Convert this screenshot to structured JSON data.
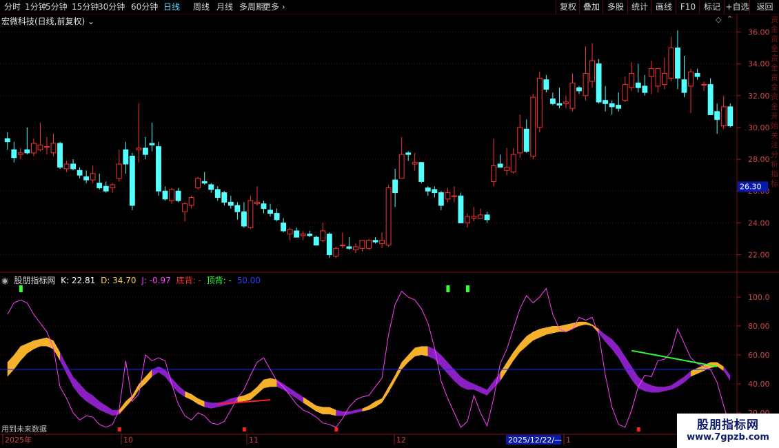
{
  "toolbar": {
    "periods": [
      "分时",
      "1分钟",
      "5分钟",
      "15分钟",
      "30分钟",
      "60分钟",
      "日线",
      "周线",
      "月线",
      "多周期",
      "更多 ›"
    ],
    "active_period": "日线",
    "actions": [
      "复权",
      "叠加",
      "多股",
      "统计",
      "画线",
      "F10",
      "标记",
      "+自选",
      "返回"
    ]
  },
  "stock_title": "宏微科技(日线,前复权) ⌄",
  "icons": {
    "diamond": "diamond-icon",
    "chevron": "chevron-up-icon",
    "circle": "indicator-menu-icon"
  },
  "price_axis": {
    "ticks": [
      "36.00",
      "34.00",
      "32.00",
      "30.00",
      "28.00",
      "26.00",
      "24.00",
      "22.00"
    ],
    "current": "26.30"
  },
  "indicator": {
    "name": "股朋指标网",
    "k": "K: 22.81",
    "d": "D: 34.70",
    "j": "J: -0.97",
    "bottom_div": "底背: -",
    "top_div": "顶背: -",
    "mid": "50.00",
    "ticks": [
      "100.0",
      "80.00",
      "60.00",
      "40.00",
      "20.00"
    ]
  },
  "footer_note": "用到未来数据",
  "date_axis": {
    "labels": [
      "2025年",
      "10",
      "11",
      "12",
      "1"
    ],
    "cursor": "2025/12/22/—"
  },
  "watermark": {
    "line1": "股朋指标网",
    "line2": "www.7gpzb.com"
  },
  "side_strip": "资金资金资金资金资金开始关注分析指标",
  "colors": {
    "up": "#ff3232",
    "down": "#54ffff",
    "kline": "#ff40ff",
    "gold": "#f5b12a",
    "purple": "#8a1fc4",
    "mid": "#1a2cff",
    "topdiv": "#33ff33",
    "botdiv": "#ff2020"
  },
  "chart_data": [
    {
      "type": "candlestick",
      "title": "宏微科技(日线,前复权)",
      "ylim": [
        21.2,
        36.8
      ],
      "ohlc": [
        [
          29.3,
          29.7,
          28.6,
          29.1
        ],
        [
          28.6,
          29.1,
          27.8,
          28.1
        ],
        [
          28.3,
          28.7,
          28.0,
          28.4
        ],
        [
          28.6,
          30.0,
          28.3,
          28.4
        ],
        [
          28.4,
          29.3,
          28.2,
          29.0
        ],
        [
          28.6,
          30.3,
          28.5,
          28.9
        ],
        [
          28.8,
          29.4,
          28.3,
          28.8
        ],
        [
          28.4,
          29.6,
          28.2,
          29.0
        ],
        [
          29.0,
          29.1,
          27.4,
          27.5
        ],
        [
          27.4,
          27.9,
          27.2,
          27.7
        ],
        [
          27.7,
          28.0,
          27.3,
          27.4
        ],
        [
          27.3,
          27.5,
          26.8,
          27.0
        ],
        [
          26.9,
          27.3,
          26.5,
          26.7
        ],
        [
          26.7,
          27.6,
          26.5,
          27.1
        ],
        [
          26.5,
          27.1,
          26.1,
          26.2
        ],
        [
          26.3,
          26.6,
          25.9,
          26.0
        ],
        [
          26.2,
          26.5,
          25.9,
          26.4
        ],
        [
          26.8,
          28.6,
          26.6,
          27.7
        ],
        [
          28.6,
          29.1,
          27.1,
          27.7
        ],
        [
          28.2,
          28.4,
          24.8,
          25.1
        ],
        [
          28.6,
          31.5,
          27.8,
          28.7
        ],
        [
          28.7,
          29.4,
          28.0,
          28.3
        ],
        [
          29.0,
          30.3,
          28.5,
          28.9
        ],
        [
          28.8,
          29.1,
          25.7,
          26.0
        ],
        [
          26.0,
          26.3,
          25.4,
          25.5
        ],
        [
          25.4,
          26.2,
          25.2,
          26.1
        ],
        [
          26.0,
          26.2,
          25.3,
          25.4
        ],
        [
          24.7,
          25.3,
          24.1,
          25.2
        ],
        [
          25.1,
          25.7,
          24.9,
          25.6
        ],
        [
          26.2,
          26.9,
          26.1,
          26.8
        ],
        [
          26.6,
          27.2,
          26.4,
          26.5
        ],
        [
          26.4,
          26.5,
          25.9,
          26.1
        ],
        [
          26.1,
          26.3,
          25.4,
          25.6
        ],
        [
          25.9,
          26.0,
          25.1,
          25.3
        ],
        [
          25.3,
          25.7,
          24.9,
          25.1
        ],
        [
          25.1,
          25.3,
          24.2,
          24.7
        ],
        [
          24.7,
          25.3,
          23.7,
          23.8
        ],
        [
          23.7,
          25.7,
          23.6,
          25.4
        ],
        [
          25.2,
          26.3,
          25.1,
          25.3
        ],
        [
          25.2,
          25.4,
          24.6,
          24.9
        ],
        [
          24.8,
          25.2,
          24.4,
          24.6
        ],
        [
          24.6,
          24.9,
          24.1,
          24.2
        ],
        [
          24.0,
          24.3,
          23.4,
          23.5
        ],
        [
          23.3,
          23.7,
          22.9,
          23.6
        ],
        [
          23.5,
          23.7,
          23.1,
          23.1
        ],
        [
          23.2,
          23.5,
          22.9,
          23.3
        ],
        [
          23.3,
          23.5,
          23.1,
          23.2
        ],
        [
          23.1,
          23.2,
          22.6,
          22.6
        ],
        [
          22.9,
          24.0,
          22.8,
          23.5
        ],
        [
          23.3,
          23.4,
          21.8,
          22.0
        ],
        [
          21.9,
          22.5,
          21.8,
          22.4
        ],
        [
          22.6,
          23.4,
          22.4,
          22.6
        ],
        [
          22.5,
          23.1,
          22.3,
          22.4
        ],
        [
          22.3,
          22.7,
          22.1,
          22.5
        ],
        [
          22.4,
          22.8,
          22.2,
          22.9
        ],
        [
          22.4,
          23.0,
          22.3,
          22.9
        ],
        [
          22.9,
          23.1,
          22.7,
          22.8
        ],
        [
          22.7,
          23.4,
          22.4,
          22.9
        ],
        [
          22.6,
          26.4,
          22.5,
          26.2
        ],
        [
          26.7,
          27.4,
          25.0,
          25.9
        ],
        [
          26.8,
          29.4,
          26.8,
          28.3
        ],
        [
          28.4,
          28.5,
          27.9,
          28.3
        ],
        [
          27.7,
          28.4,
          27.3,
          27.8
        ],
        [
          27.8,
          27.8,
          26.5,
          26.6
        ],
        [
          26.2,
          26.3,
          25.7,
          26.0
        ],
        [
          26.1,
          26.3,
          25.6,
          25.9
        ],
        [
          25.9,
          26.0,
          24.8,
          25.1
        ],
        [
          25.5,
          26.2,
          25.3,
          25.9
        ],
        [
          25.7,
          26.3,
          25.3,
          25.7
        ],
        [
          25.7,
          25.9,
          24.0,
          24.0
        ],
        [
          24.0,
          24.6,
          23.7,
          24.4
        ],
        [
          24.3,
          25.0,
          24.1,
          24.4
        ],
        [
          24.3,
          24.9,
          24.3,
          24.5
        ],
        [
          24.5,
          24.7,
          24.0,
          24.2
        ],
        [
          26.6,
          29.3,
          26.3,
          27.6
        ],
        [
          27.7,
          28.3,
          27.5,
          27.5
        ],
        [
          27.3,
          28.7,
          27.0,
          27.5
        ],
        [
          27.2,
          28.7,
          27.1,
          28.3
        ],
        [
          28.4,
          30.8,
          28.1,
          30.0
        ],
        [
          29.9,
          30.5,
          28.4,
          28.5
        ],
        [
          28.2,
          32.1,
          28.0,
          31.9
        ],
        [
          30.0,
          33.5,
          29.7,
          33.1
        ],
        [
          33.0,
          33.3,
          32.2,
          32.4
        ],
        [
          31.8,
          32.2,
          31.4,
          31.5
        ],
        [
          31.5,
          32.5,
          31.2,
          31.4
        ],
        [
          31.5,
          32.0,
          31.2,
          31.6
        ],
        [
          31.2,
          33.4,
          31.0,
          32.8
        ],
        [
          32.5,
          32.6,
          32.1,
          32.3
        ],
        [
          32.0,
          35.1,
          31.7,
          33.4
        ],
        [
          32.9,
          35.3,
          32.5,
          34.2
        ],
        [
          34.0,
          34.3,
          31.5,
          31.6
        ],
        [
          31.7,
          32.6,
          31.0,
          31.5
        ],
        [
          31.5,
          31.7,
          30.8,
          31.3
        ],
        [
          31.4,
          32.2,
          31.0,
          31.2
        ],
        [
          31.7,
          33.2,
          31.6,
          32.7
        ],
        [
          32.5,
          34.1,
          32.3,
          33.4
        ],
        [
          32.8,
          34.0,
          32.2,
          32.5
        ],
        [
          32.6,
          33.3,
          32.0,
          32.2
        ],
        [
          33.2,
          34.2,
          32.1,
          33.7
        ],
        [
          32.6,
          33.7,
          32.2,
          33.7
        ],
        [
          32.7,
          34.4,
          32.4,
          33.4
        ],
        [
          33.1,
          35.7,
          32.9,
          35.0
        ],
        [
          35.0,
          36.1,
          32.4,
          33.1
        ],
        [
          33.0,
          34.5,
          31.9,
          32.2
        ],
        [
          32.6,
          33.7,
          30.9,
          33.5
        ],
        [
          33.4,
          33.7,
          33.0,
          33.2
        ],
        [
          32.7,
          32.9,
          32.3,
          32.7
        ],
        [
          32.7,
          33.1,
          31.0,
          30.8
        ],
        [
          31.0,
          31.5,
          29.6,
          30.5
        ],
        [
          30.1,
          32.0,
          29.9,
          31.3
        ],
        [
          31.3,
          31.5,
          30.0,
          30.1
        ]
      ],
      "current_price": 26.3
    },
    {
      "type": "line",
      "title": "股朋指标网",
      "ylim": [
        10,
        110
      ],
      "reference": 50,
      "k": [
        55,
        60,
        66,
        68,
        70,
        71,
        72,
        70,
        62,
        53,
        45,
        40,
        35,
        32,
        28,
        25,
        22,
        22,
        28,
        32,
        40,
        45,
        50,
        52,
        50,
        44,
        39,
        35,
        33,
        30,
        28,
        27,
        27,
        28,
        30,
        31,
        32,
        34,
        38,
        43,
        44,
        43,
        40,
        37,
        34,
        31,
        28,
        25,
        24,
        24,
        22,
        21,
        21,
        22,
        23,
        25,
        28,
        30,
        38,
        46,
        55,
        60,
        65,
        66,
        66,
        64,
        60,
        55,
        50,
        45,
        42,
        40,
        38,
        36,
        42,
        48,
        55,
        62,
        68,
        73,
        76,
        78,
        79,
        80,
        80,
        81,
        82,
        83,
        83,
        81,
        78,
        74,
        71,
        66,
        59,
        52,
        45,
        41,
        39,
        38,
        38,
        39,
        42,
        45,
        49,
        51,
        53,
        55,
        55,
        52,
        46,
        40,
        35,
        30
      ],
      "d": [
        45,
        50,
        56,
        61,
        64,
        66,
        66,
        64,
        56,
        47,
        38,
        32,
        28,
        25,
        22,
        20,
        18,
        19,
        24,
        29,
        36,
        40,
        45,
        48,
        45,
        39,
        34,
        31,
        29,
        26,
        24,
        23,
        24,
        25,
        26,
        27,
        28,
        29,
        33,
        37,
        38,
        38,
        36,
        33,
        30,
        27,
        24,
        21,
        19,
        19,
        18,
        18,
        19,
        20,
        21,
        22,
        24,
        27,
        34,
        42,
        50,
        55,
        59,
        60,
        59,
        57,
        52,
        47,
        42,
        38,
        36,
        36,
        34,
        32,
        37,
        42,
        49,
        56,
        62,
        66,
        70,
        72,
        74,
        75,
        76,
        76,
        78,
        80,
        81,
        80,
        75,
        69,
        64,
        58,
        50,
        43,
        37,
        35,
        34,
        34,
        35,
        36,
        38,
        41,
        45,
        47,
        49,
        51,
        52,
        49,
        42,
        36,
        30,
        24
      ],
      "j": [
        88,
        96,
        98,
        96,
        88,
        82,
        76,
        65,
        38,
        30,
        20,
        15,
        18,
        17,
        12,
        10,
        12,
        22,
        56,
        28,
        33,
        60,
        56,
        58,
        56,
        40,
        26,
        18,
        15,
        20,
        18,
        13,
        12,
        14,
        22,
        30,
        36,
        46,
        55,
        58,
        50,
        42,
        38,
        32,
        26,
        22,
        20,
        17,
        13,
        12,
        10,
        16,
        24,
        29,
        31,
        32,
        38,
        44,
        74,
        95,
        104,
        100,
        98,
        92,
        82,
        65,
        42,
        30,
        20,
        10,
        14,
        32,
        20,
        11,
        30,
        54,
        64,
        78,
        92,
        101,
        96,
        100,
        106,
        88,
        78,
        76,
        78,
        86,
        84,
        86,
        74,
        46,
        24,
        12,
        8,
        22,
        38,
        46,
        45,
        56,
        57,
        62,
        78,
        68,
        58,
        54,
        52,
        50,
        41,
        25,
        10,
        8,
        5,
        2
      ],
      "gold_spans": [
        [
          0,
          7
        ],
        [
          17,
          21
        ],
        [
          27,
          29
        ],
        [
          35,
          40
        ],
        [
          45,
          49
        ],
        [
          54,
          63
        ],
        [
          75,
          89
        ],
        [
          104,
          108
        ]
      ],
      "purple_spans": [
        [
          8,
          16
        ],
        [
          22,
          26
        ],
        [
          30,
          34
        ],
        [
          41,
          44
        ],
        [
          50,
          53
        ],
        [
          64,
          74
        ],
        [
          90,
          103
        ],
        [
          109,
          113
        ]
      ],
      "top_markers": [
        2,
        67,
        70
      ],
      "bottom_markers": [
        17,
        36,
        50,
        96
      ],
      "top_div_line": [
        [
          95,
          63
        ],
        [
          108,
          52
        ]
      ],
      "bottom_div_line": [
        [
          32,
          26
        ],
        [
          40,
          29
        ]
      ]
    }
  ]
}
